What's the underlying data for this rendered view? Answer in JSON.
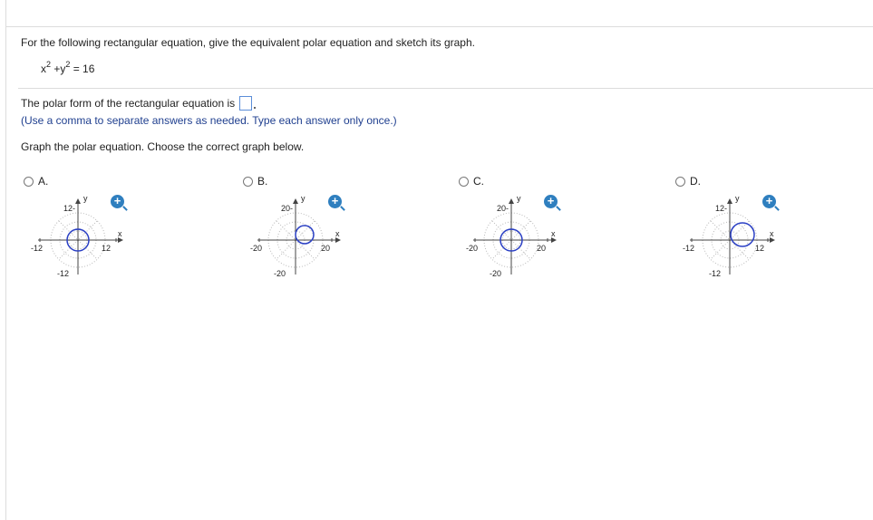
{
  "question": {
    "instructions": "For the following rectangular equation, give the equivalent polar equation and sketch its graph.",
    "equation": {
      "x": "x",
      "exp1": "2",
      "plus": " +y",
      "exp2": "2",
      "rest": " = 16"
    },
    "polar_prefix": "The polar form of the rectangular equation is",
    "hint": "(Use a comma to separate answers as needed. Type each answer only once.)",
    "graph_prompt": "Graph the polar equation. Choose the correct graph below."
  },
  "choices": [
    {
      "label": "A.",
      "x_axis": "x",
      "y_axis": "y",
      "pos_x": "12",
      "neg_x": "-12",
      "pos_y": "12-",
      "neg_y": "-12"
    },
    {
      "label": "B.",
      "x_axis": "x",
      "y_axis": "y",
      "pos_x": "20",
      "neg_x": "-20",
      "pos_y": "20-",
      "neg_y": "-20"
    },
    {
      "label": "C.",
      "x_axis": "x",
      "y_axis": "y",
      "pos_x": "20",
      "neg_x": "-20",
      "pos_y": "20-",
      "neg_y": "-20"
    },
    {
      "label": "D.",
      "x_axis": "x",
      "y_axis": "y",
      "pos_x": "12",
      "neg_x": "-12",
      "pos_y": "12-",
      "neg_y": "-12"
    }
  ],
  "zoom_icon": "zoom-in-icon",
  "colors": {
    "accent": "#2f7fbf",
    "circle": "#2a3fc4",
    "hint": "#1f3f8f",
    "input_border": "#5b8ed8"
  }
}
